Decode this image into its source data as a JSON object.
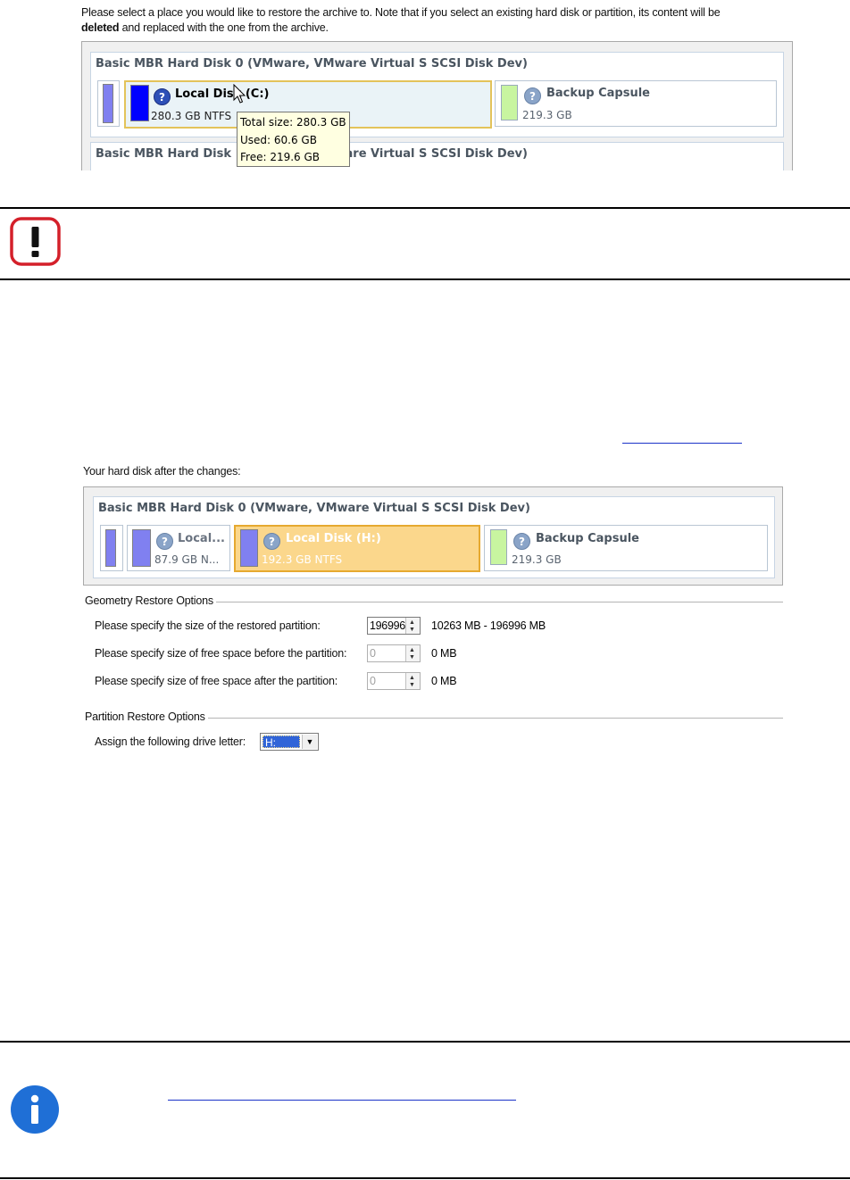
{
  "top_section": {
    "instruction_line1": "Please select a place you would like to restore the archive to. Note that if you select an existing hard disk or partition, its content will be",
    "instruction_bold": "deleted",
    "instruction_rest": " and replaced with the one from the archive.",
    "disk0_title": "Basic MBR Hard Disk 0 (VMware, VMware Virtual S SCSI Disk Dev)",
    "disk1_title": "Basic MBR Hard Disk 1 (VMware, VMware Virtual S SCSI Disk Dev)",
    "selected_partition": {
      "name": "Local Disk (C:)",
      "size": "280.3 GB NTFS"
    },
    "capsule_partition": {
      "name": "Backup Capsule",
      "size": "219.3 GB"
    },
    "tooltip": {
      "total": "Total size: 280.3 GB",
      "used": "Used: 60.6 GB",
      "free": "Free: 219.6 GB"
    }
  },
  "bottom_section": {
    "caption": "Your hard disk after the changes:",
    "disk0_title": "Basic MBR Hard Disk 0 (VMware, VMware Virtual S SCSI Disk Dev)",
    "partitions": [
      {
        "name": "Local...",
        "size": "87.9 GB N..."
      },
      {
        "name": "Local Disk (H:)",
        "size": "192.3 GB NTFS"
      },
      {
        "name": "Backup Capsule",
        "size": "219.3 GB"
      }
    ],
    "geometry_group": "Geometry Restore Options",
    "geometry_options": [
      {
        "label": "Please specify the size of the restored partition:",
        "value": "196996",
        "unit": "10263 MB - 196996 MB",
        "enabled": true
      },
      {
        "label": "Please specify size of free space before the partition:",
        "value": "0",
        "unit": "0 MB",
        "enabled": false
      },
      {
        "label": "Please specify size of free space after the partition:",
        "value": "0",
        "unit": "0 MB",
        "enabled": false
      }
    ],
    "partition_group": "Partition Restore Options",
    "drive_letter_label": "Assign the following drive letter:",
    "drive_letter_value": "H:"
  },
  "icons": {
    "warning": "exclamation-warning-icon",
    "info": "info-icon",
    "question": "question-icon",
    "cursor": "mouse-pointer-icon"
  },
  "colors": {
    "warning_red": "#d4202a",
    "info_blue": "#1f6fd6",
    "link_blue": "#1a33c8",
    "selected_orange": "#f4b840",
    "partition_blue": "#0000ff",
    "partition_lavender": "#8080f0",
    "capsule_green": "#c8f5a0",
    "tooltip_bg": "#ffffe1"
  }
}
